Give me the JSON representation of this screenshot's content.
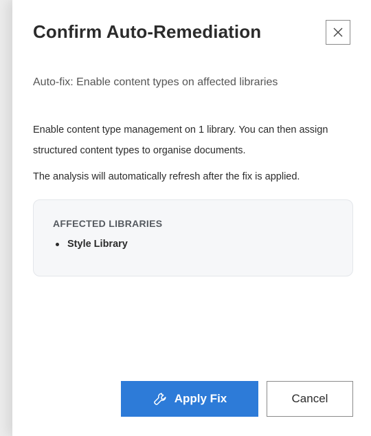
{
  "dialog": {
    "title": "Confirm Auto-Remediation",
    "close_icon": "close-icon",
    "subtitle": "Auto-fix: Enable content types on affected libraries",
    "paragraphs": [
      "Enable content type management on 1 library. You can then assign structured content types to organise documents.",
      "The analysis will automatically refresh after the fix is applied."
    ],
    "affected": {
      "heading": "AFFECTED LIBRARIES",
      "items": [
        "Style Library"
      ]
    },
    "buttons": {
      "apply_label": "Apply Fix",
      "apply_icon": "wrench-icon",
      "cancel_label": "Cancel"
    }
  },
  "colors": {
    "primary": "#2d7bd8",
    "text": "#2b2b2b",
    "muted": "#555555",
    "box_bg": "#f6f7f9"
  }
}
